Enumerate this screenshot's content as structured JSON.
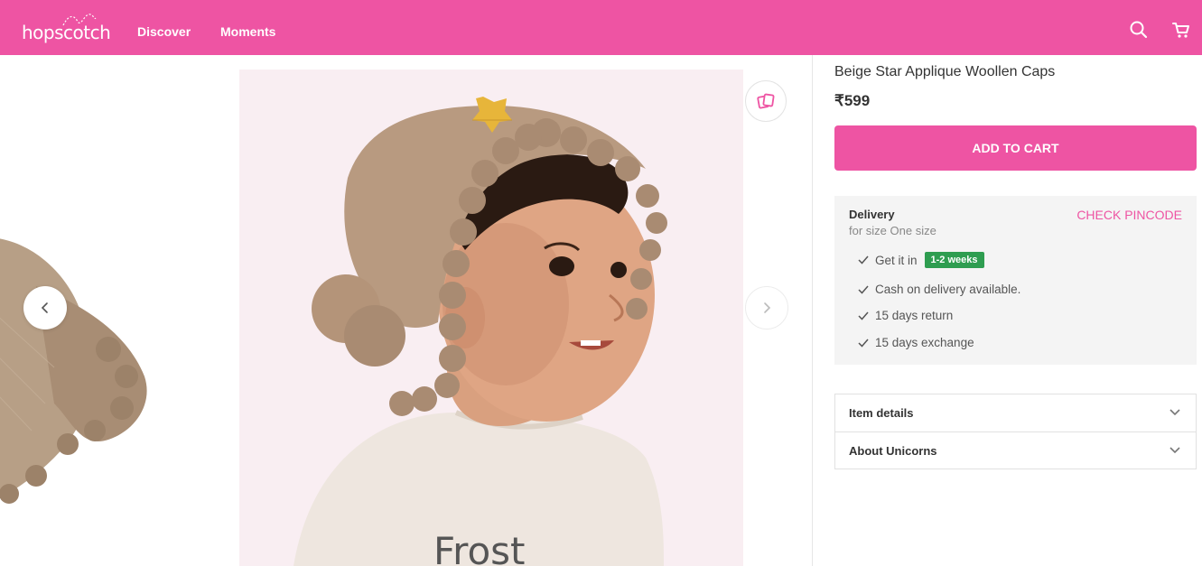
{
  "header": {
    "logo_text": "hopscotch",
    "nav": [
      {
        "label": "Discover"
      },
      {
        "label": "Moments"
      }
    ],
    "icons": [
      "search-icon",
      "cart-icon"
    ],
    "brand_color": "#ee54a3"
  },
  "product": {
    "title": "Beige Star Applique Woollen Caps",
    "price": "₹599",
    "add_to_cart": "ADD TO CART"
  },
  "delivery": {
    "title": "Delivery",
    "subtitle": "for size One size",
    "check_pincode": "CHECK PINCODE",
    "get_it_in": "Get it in",
    "eta_badge": "1-2 weeks",
    "cod": "Cash on delivery available.",
    "returns": "15 days return",
    "exchange": "15 days exchange",
    "badge_color": "#2e9d50"
  },
  "accordion": [
    {
      "label": "Item details"
    },
    {
      "label": "About Unicorns"
    }
  ],
  "gallery": {
    "icons": [
      "chevron-left-icon",
      "chevron-right-icon",
      "similar-products-icon"
    ],
    "photo_text": "Frost"
  }
}
